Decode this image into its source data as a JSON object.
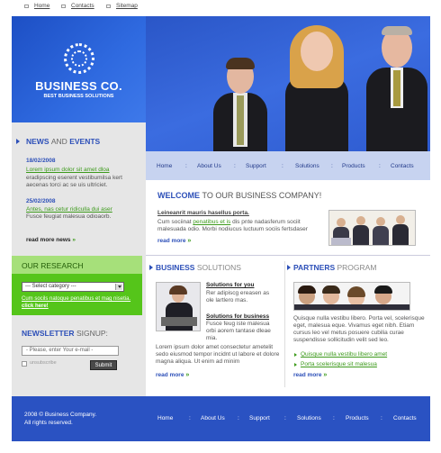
{
  "util": {
    "home": "Home",
    "contacts": "Contacts",
    "sitemap": "Sitemap"
  },
  "logo": {
    "title": "BUSINESS CO.",
    "subtitle": "BEST BUSINESS SOLUTIONS"
  },
  "nav": [
    "Home",
    "About Us",
    "Support",
    "Solutions",
    "Products",
    "Contacts"
  ],
  "news": {
    "title_a": "NEWS",
    "title_b": "AND",
    "title_c": "EVENTS",
    "items": [
      {
        "date": "18/02/2008",
        "link": "Lorem ipsum dolor sit amet dloa",
        "text": "eradipscing eserent vestibumilsa kert aecenas torci ac se uis ultriciet."
      },
      {
        "date": "25/02/2008",
        "link": "Antes, nas cetur ridiculla dui aser",
        "text": "Fusce feugiat malesua odioaorb."
      }
    ],
    "read_more": "read more news"
  },
  "research": {
    "title": "OUR RESEARCH",
    "select": "--- Select category ---",
    "link": "Cum socils natoque penatibus et mag nisetia.",
    "link_bold": "click here!"
  },
  "newsletter": {
    "title_a": "NEWSLETTER",
    "title_b": "SIGNUP:",
    "placeholder": "- Please, enter Your e-mail -",
    "checkbox": "unsubscribe",
    "submit": "Submit"
  },
  "welcome": {
    "title_a": "WELCOME",
    "title_b": "TO OUR BUSINESS COMPANY!",
    "subtitle": "Leineanrit mauris hasellus porta.",
    "text_a": "Cum sociinat",
    "text_link": "penatibus et is",
    "text_b": "dis pnte nadasferum sociit malesuada odio. Morbi nodiucus luctuum sociis fertsdaser",
    "read_more": "read more"
  },
  "business": {
    "title_a": "BUSINESS",
    "title_b": "SOLUTIONS",
    "item1_title": "Solutions for you",
    "item1_text": "Rer adipiscg ereasen as ole lartlero mas.",
    "item2_title": "Solutions for business",
    "item2_text": "Fusce feug iste malesua orbi aorem tantase dleae mia.",
    "text": "Lorem ipsum dolor amet consectetur ametelit sedo eiusmod tempor incidnt ut labore et dolore magna aliqua. Ut enim ad minim",
    "read_more": "read more"
  },
  "partners": {
    "title_a": "PARTNERS",
    "title_b": "PROGRAM",
    "text": "Quisque nulla vestibu libero. Porta vel, scelerisque eget, malesua eque. Vivamus eget nibh. Etiam cursus leo vel metus posuere cubilia curae suspendisse sollicitudin velit sed leo.",
    "links": [
      "Quisque nulla vestibu libero amet",
      "Porta scelerisque sit malesua"
    ],
    "read_more": "read more"
  },
  "footer": {
    "copy_a": "2008 © Business Company.",
    "copy_b": "All rights reserved.",
    "nav": [
      "Home",
      "About Us",
      "Support",
      "Solutions",
      "Products",
      "Contacts"
    ]
  },
  "colors": {
    "primary": "#2c4fb8",
    "green": "#55c51a",
    "nav_bg": "#c7d3f0"
  }
}
